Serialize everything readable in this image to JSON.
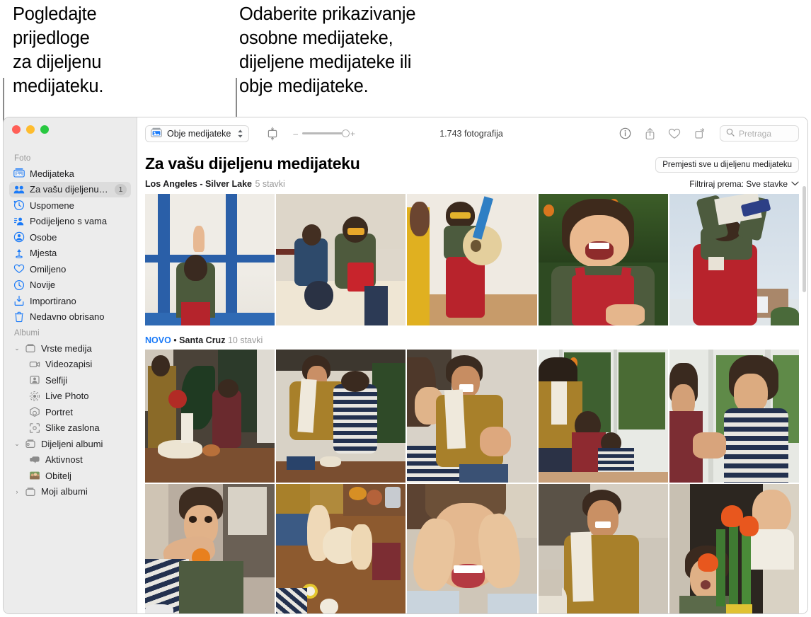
{
  "callouts": {
    "left": "Pogledajte\nprijedloge\nza dijeljenu\nmedijateku.",
    "right": "Odaberite prikazivanje\nosobne medijateke,\ndijeljene medijateke ili\nobje medijateke."
  },
  "sidebar": {
    "sections": [
      {
        "label": "Foto",
        "items": [
          {
            "label": "Medijateka",
            "icon": "photos-library-icon",
            "level": 1,
            "selected": false,
            "badge": null,
            "disclosure": null
          },
          {
            "label": "Za vašu dijeljenu medij...",
            "icon": "shared-library-people-icon",
            "level": 1,
            "selected": true,
            "badge": "1",
            "disclosure": null
          },
          {
            "label": "Uspomene",
            "icon": "memories-icon",
            "level": 1,
            "selected": false,
            "badge": null,
            "disclosure": null
          },
          {
            "label": "Podijeljeno s vama",
            "icon": "shared-with-you-icon",
            "level": 1,
            "selected": false,
            "badge": null,
            "disclosure": null
          },
          {
            "label": "Osobe",
            "icon": "people-icon",
            "level": 1,
            "selected": false,
            "badge": null,
            "disclosure": null
          },
          {
            "label": "Mjesta",
            "icon": "places-pin-icon",
            "level": 1,
            "selected": false,
            "badge": null,
            "disclosure": null
          },
          {
            "label": "Omiljeno",
            "icon": "heart-icon",
            "level": 1,
            "selected": false,
            "badge": null,
            "disclosure": null
          },
          {
            "label": "Novije",
            "icon": "clock-icon",
            "level": 1,
            "selected": false,
            "badge": null,
            "disclosure": null
          },
          {
            "label": "Importirano",
            "icon": "import-icon",
            "level": 1,
            "selected": false,
            "badge": null,
            "disclosure": null
          },
          {
            "label": "Nedavno obrisano",
            "icon": "trash-icon",
            "level": 1,
            "selected": false,
            "badge": null,
            "disclosure": null
          }
        ]
      },
      {
        "label": "Albumi",
        "items": [
          {
            "label": "Vrste medija",
            "icon": "album-folder-icon",
            "level": 0,
            "selected": false,
            "badge": null,
            "disclosure": "down"
          },
          {
            "label": "Videozapisi",
            "icon": "video-icon",
            "level": 2,
            "selected": false,
            "badge": null,
            "disclosure": null
          },
          {
            "label": "Selfiji",
            "icon": "selfie-icon",
            "level": 2,
            "selected": false,
            "badge": null,
            "disclosure": null
          },
          {
            "label": "Live Photo",
            "icon": "live-photo-icon",
            "level": 2,
            "selected": false,
            "badge": null,
            "disclosure": null
          },
          {
            "label": "Portret",
            "icon": "portrait-cube-icon",
            "level": 2,
            "selected": false,
            "badge": null,
            "disclosure": null
          },
          {
            "label": "Slike zaslona",
            "icon": "screenshot-icon",
            "level": 2,
            "selected": false,
            "badge": null,
            "disclosure": null
          },
          {
            "label": "Dijeljeni albumi",
            "icon": "shared-album-icon",
            "level": 0,
            "selected": false,
            "badge": null,
            "disclosure": "down"
          },
          {
            "label": "Aktivnost",
            "icon": "activity-bubbles-icon",
            "level": 2,
            "selected": false,
            "badge": null,
            "disclosure": null
          },
          {
            "label": "Obitelj",
            "icon": "family-thumbnail-icon",
            "level": 2,
            "selected": false,
            "badge": null,
            "disclosure": null
          },
          {
            "label": "Moji albumi",
            "icon": "album-folder-icon",
            "level": 0,
            "selected": false,
            "badge": null,
            "disclosure": "right"
          }
        ]
      }
    ]
  },
  "toolbar": {
    "library_popup_label": "Obje medijateke",
    "library_popup_icon": "photos-library-icon",
    "aspect_icon": "aspect-ratio-icon",
    "zoom_minus": "–",
    "zoom_plus": "+",
    "photo_count": "1.743 fotografija",
    "info_icon": "info-icon",
    "share_icon": "share-icon",
    "favorite_icon": "heart-icon",
    "rotate_icon": "rotate-icon",
    "search_icon": "search-icon",
    "search_placeholder": "Pretraga",
    "search_value": ""
  },
  "content": {
    "title": "Za vašu dijeljenu medijateku",
    "move_all_button": "Premjesti sve u dijeljenu medijateku",
    "filter_label": "Filtriraj prema: Sve stavke",
    "filter_chevron_icon": "chevron-down-icon",
    "sections": [
      {
        "new_badge": null,
        "title": "Los Angeles - Silver Lake",
        "count": "5 stavki",
        "rows": 1,
        "photos": [
          {
            "name": "child-at-blue-window"
          },
          {
            "name": "two-kids-on-bed-with-book"
          },
          {
            "name": "child-playing-ukulele"
          },
          {
            "name": "smiling-child-outdoors"
          },
          {
            "name": "child-with-paper-megaphone"
          }
        ]
      },
      {
        "new_badge": "NOVO",
        "title": "Santa Cruz",
        "count": "10 stavki",
        "rows": 2,
        "photos": [
          {
            "name": "mother-and-child-baking-by-window"
          },
          {
            "name": "mother-helping-child-at-counter"
          },
          {
            "name": "smiling-mother-with-child-foreground"
          },
          {
            "name": "family-by-garden-window"
          },
          {
            "name": "two-children-at-window"
          },
          {
            "name": "child-eating-fruit"
          },
          {
            "name": "hands-kneading-dough-on-table"
          },
          {
            "name": "child-with-floury-hands-on-face"
          },
          {
            "name": "smiling-woman-with-towel"
          },
          {
            "name": "baby-and-child-with-tulips"
          }
        ]
      }
    ]
  },
  "colors": {
    "accent": "#1a7af8",
    "sidebar_bg": "#ececec",
    "selected_bg": "#dcdcdc",
    "traffic_red": "#ff5f57",
    "traffic_yellow": "#febc2e",
    "traffic_green": "#28c840"
  }
}
